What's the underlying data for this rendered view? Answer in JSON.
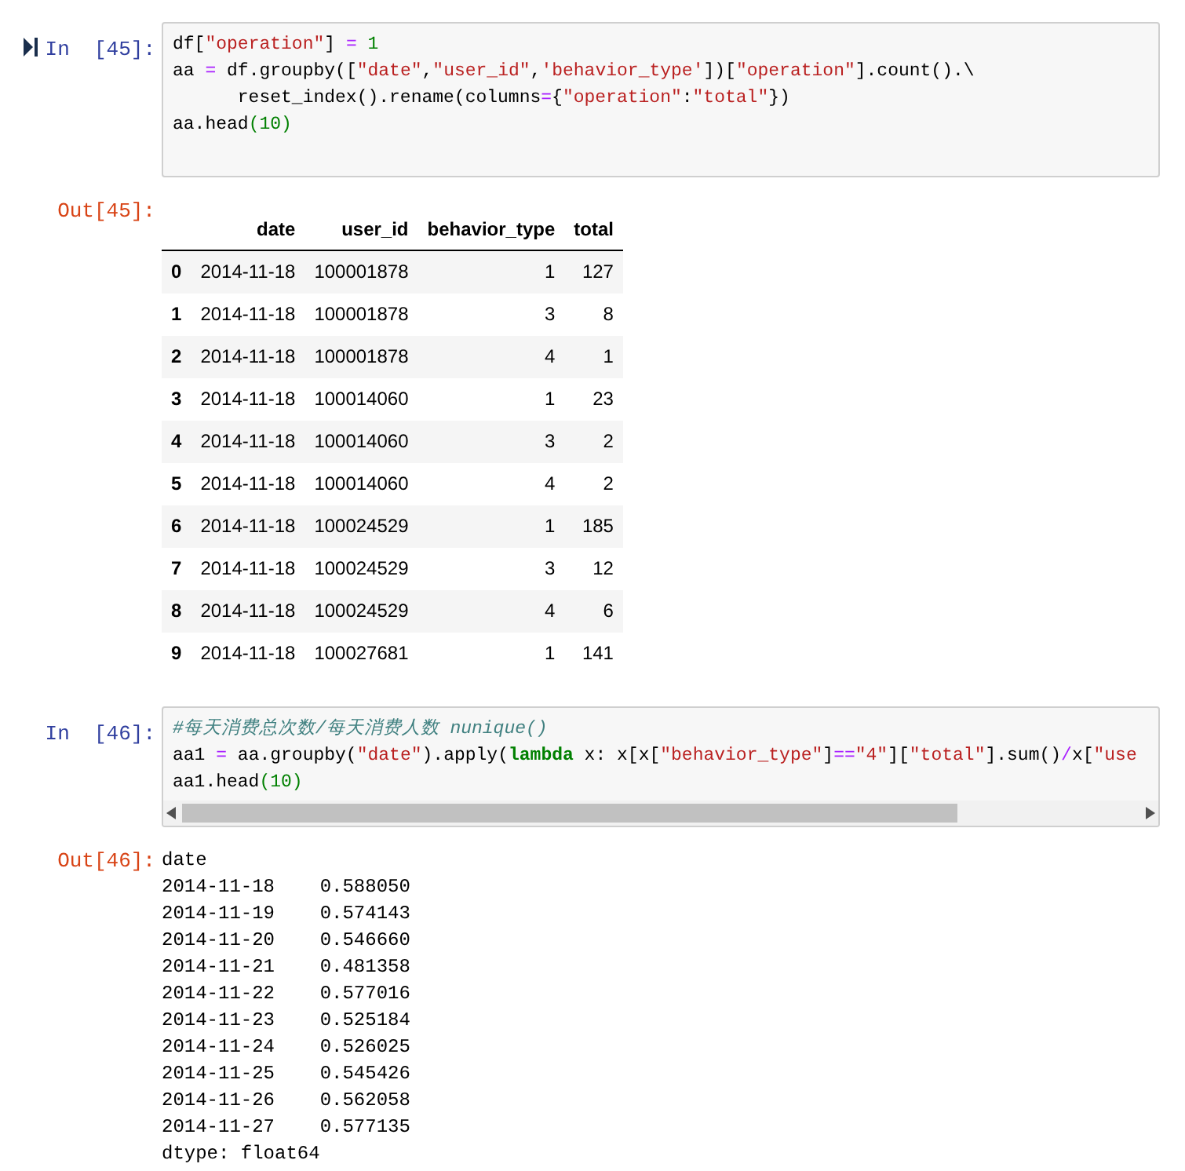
{
  "cells": [
    {
      "prompt": "In  [45]:",
      "current": true,
      "scrollbar": false,
      "code": [
        [
          {
            "text": "df[",
            "kind": "plain"
          },
          {
            "text": "\"operation\"",
            "kind": "string"
          },
          {
            "text": "] ",
            "kind": "plain"
          },
          {
            "text": "=",
            "kind": "op"
          },
          {
            "text": " 1",
            "kind": "number"
          }
        ],
        [
          {
            "text": "aa ",
            "kind": "plain"
          },
          {
            "text": "=",
            "kind": "op"
          },
          {
            "text": " df.groupby([",
            "kind": "plain"
          },
          {
            "text": "\"date\"",
            "kind": "string"
          },
          {
            "text": ",",
            "kind": "plain"
          },
          {
            "text": "\"user_id\"",
            "kind": "string"
          },
          {
            "text": ",",
            "kind": "plain"
          },
          {
            "text": "'behavior_type'",
            "kind": "string"
          },
          {
            "text": "])[",
            "kind": "plain"
          },
          {
            "text": "\"operation\"",
            "kind": "string"
          },
          {
            "text": "].count().\\",
            "kind": "plain"
          }
        ],
        [
          {
            "text": "      reset_index().rename(columns",
            "kind": "plain"
          },
          {
            "text": "=",
            "kind": "op"
          },
          {
            "text": "{",
            "kind": "plain"
          },
          {
            "text": "\"operation\"",
            "kind": "string"
          },
          {
            "text": ":",
            "kind": "plain"
          },
          {
            "text": "\"total\"",
            "kind": "string"
          },
          {
            "text": "})",
            "kind": "plain"
          }
        ],
        [
          {
            "text": "aa.head",
            "kind": "plain"
          },
          {
            "text": "(10)",
            "kind": "number"
          }
        ]
      ],
      "output": {
        "kind": "table",
        "prompt": "Out[45]:",
        "columns": [
          "",
          "date",
          "user_id",
          "behavior_type",
          "total"
        ],
        "rows": [
          [
            "0",
            "2014-11-18",
            "100001878",
            "1",
            "127"
          ],
          [
            "1",
            "2014-11-18",
            "100001878",
            "3",
            "8"
          ],
          [
            "2",
            "2014-11-18",
            "100001878",
            "4",
            "1"
          ],
          [
            "3",
            "2014-11-18",
            "100014060",
            "1",
            "23"
          ],
          [
            "4",
            "2014-11-18",
            "100014060",
            "3",
            "2"
          ],
          [
            "5",
            "2014-11-18",
            "100014060",
            "4",
            "2"
          ],
          [
            "6",
            "2014-11-18",
            "100024529",
            "1",
            "185"
          ],
          [
            "7",
            "2014-11-18",
            "100024529",
            "3",
            "12"
          ],
          [
            "8",
            "2014-11-18",
            "100024529",
            "4",
            "6"
          ],
          [
            "9",
            "2014-11-18",
            "100027681",
            "1",
            "141"
          ]
        ]
      }
    },
    {
      "prompt": "In  [46]:",
      "current": false,
      "scrollbar": true,
      "code": [
        [
          {
            "text": "#每天消费总次数/每天消费人数 nunique()",
            "kind": "comment"
          }
        ],
        [
          {
            "text": "aa1 ",
            "kind": "plain"
          },
          {
            "text": "=",
            "kind": "op"
          },
          {
            "text": " aa.groupby(",
            "kind": "plain"
          },
          {
            "text": "\"date\"",
            "kind": "string"
          },
          {
            "text": ").apply(",
            "kind": "plain"
          },
          {
            "text": "lambda",
            "kind": "keyword"
          },
          {
            "text": " x: x[x[",
            "kind": "plain"
          },
          {
            "text": "\"behavior_type\"",
            "kind": "string"
          },
          {
            "text": "]",
            "kind": "plain"
          },
          {
            "text": "==",
            "kind": "op"
          },
          {
            "text": "\"4\"",
            "kind": "string"
          },
          {
            "text": "][",
            "kind": "plain"
          },
          {
            "text": "\"total\"",
            "kind": "string"
          },
          {
            "text": "].sum()",
            "kind": "plain"
          },
          {
            "text": "/",
            "kind": "op"
          },
          {
            "text": "x[",
            "kind": "plain"
          },
          {
            "text": "\"use",
            "kind": "string"
          }
        ],
        [
          {
            "text": "aa1.head",
            "kind": "plain"
          },
          {
            "text": "(10)",
            "kind": "number"
          }
        ]
      ],
      "output": {
        "kind": "text",
        "prompt": "Out[46]:",
        "lines": [
          "date",
          "2014-11-18    0.588050",
          "2014-11-19    0.574143",
          "2014-11-20    0.546660",
          "2014-11-21    0.481358",
          "2014-11-22    0.577016",
          "2014-11-23    0.525184",
          "2014-11-24    0.526025",
          "2014-11-25    0.545426",
          "2014-11-26    0.562058",
          "2014-11-27    0.577135",
          "dtype: float64"
        ]
      }
    }
  ]
}
